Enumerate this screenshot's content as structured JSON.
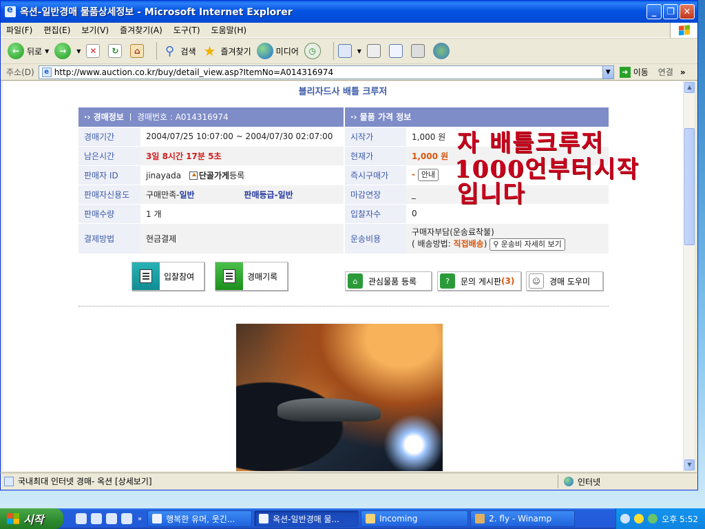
{
  "window": {
    "title": "옥션-일반경매 물품상세정보 - Microsoft Internet Explorer"
  },
  "menu": [
    "파일(F)",
    "편집(E)",
    "보기(V)",
    "즐겨찾기(A)",
    "도구(T)",
    "도움말(H)"
  ],
  "toolbar": {
    "back": "뒤로",
    "search": "검색",
    "favorites": "즐겨찾기",
    "media": "미디어"
  },
  "address": {
    "label": "주소(D)",
    "url": "http://www.auction.co.kr/buy/detail_view.asp?ItemNo=A014316974",
    "go": "이동",
    "links": "연결"
  },
  "page": {
    "title": "블리자드사 배틀 크루저",
    "auction_header": "·› 경매정보",
    "auction_no_label": "ㅣ 경매번호 : ",
    "auction_no": "A014316974",
    "price_header": "·› 물품 가격 정보",
    "rows": [
      {
        "k": "경매기간",
        "v": "2004/07/25 10:07:00 ~ 2004/07/30 02:07:00",
        "pk": "시작가",
        "pv": "1,000 원"
      },
      {
        "k": "남은시간",
        "v": "3일 8시간 17분 5초",
        "pk": "현재가",
        "pv": "1,000 원"
      },
      {
        "k": "판매자 ID",
        "v": "jinayada",
        "v2": "단골가게",
        "v3": "등록",
        "pk": "즉시구매가",
        "pv": "-",
        "pv2": "안내"
      },
      {
        "k": "판매자신용도",
        "v": "구매만족-",
        "v2": "일반",
        "v3": "판매등급-",
        "v4": "일반",
        "pk": "마감연장",
        "pv": "_"
      },
      {
        "k": "판매수량",
        "v": "1 개",
        "pk": "입찰자수",
        "pv": "0"
      },
      {
        "k": "결제방법",
        "v": "현금결제",
        "pk": "운송비용",
        "pv": "구매자부담(운송료착불)",
        "pv2": "( 배송방법:",
        "pv3": "직접배송",
        "pv4": ")",
        "pv5": "운송비 자세히 보기"
      }
    ],
    "buttons": {
      "bid": "입찰참여",
      "history": "경매기록",
      "watch": "관심물품 등록",
      "board": "문의 게시판",
      "board_count": "(3)",
      "help": "경매 도우미"
    },
    "overlay_lines": [
      "자 배틀크루저",
      "1000언부터시작",
      "입니다"
    ]
  },
  "status": {
    "text": "국내최대 인터넷 경매- 옥션 [상세보기]",
    "zone": "인터넷"
  },
  "taskbar": {
    "start": "시작",
    "tasks": [
      "행복한 유머, 웃긴...",
      "옥션-일반경매 물...",
      "Incoming",
      "2. fly - Winamp"
    ],
    "clock": "오후 5:52"
  }
}
